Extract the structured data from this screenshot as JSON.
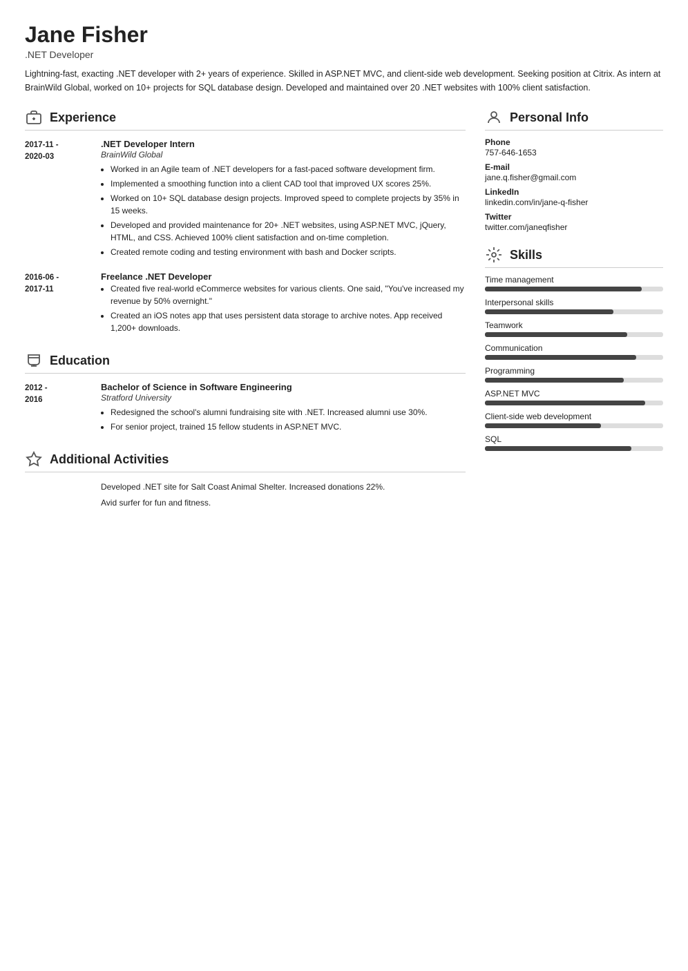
{
  "header": {
    "name": "Jane Fisher",
    "title": ".NET Developer",
    "summary": "Lightning-fast, exacting .NET developer with 2+ years of experience. Skilled in ASP.NET MVC, and client-side web development. Seeking position at Citrix. As intern at BrainWild Global, worked on 10+ projects for SQL database design. Developed and maintained over 20 .NET websites with 100% client satisfaction."
  },
  "experience": {
    "section_title": "Experience",
    "entries": [
      {
        "date_start": "2017-11 -",
        "date_end": "2020-03",
        "title": ".NET Developer Intern",
        "company": "BrainWild Global",
        "bullets": [
          "Worked in an Agile team of .NET developers for a fast-paced software development firm.",
          "Implemented a smoothing function into a client CAD tool that improved UX scores 25%.",
          "Worked on 10+ SQL database design projects. Improved speed to complete projects by 35% in 15 weeks.",
          "Developed and provided maintenance for 20+ .NET websites, using ASP.NET MVC, jQuery, HTML, and CSS. Achieved 100% client satisfaction and on-time completion.",
          "Created remote coding and testing environment with bash and Docker scripts."
        ]
      },
      {
        "date_start": "2016-06 -",
        "date_end": "2017-11",
        "title": "Freelance .NET Developer",
        "company": "",
        "bullets": [
          "Created five real-world eCommerce websites for various clients. One said, \"You've increased my revenue by 50% overnight.\"",
          "Created an iOS notes app that uses persistent data storage to archive notes. App received 1,200+ downloads."
        ]
      }
    ]
  },
  "education": {
    "section_title": "Education",
    "entries": [
      {
        "date_start": "2012 -",
        "date_end": "2016",
        "degree": "Bachelor of Science in Software Engineering",
        "school": "Stratford University",
        "bullets": [
          "Redesigned the school's alumni fundraising site with .NET. Increased alumni use 30%.",
          "For senior project, trained 15 fellow students in ASP.NET MVC."
        ]
      }
    ]
  },
  "additional_activities": {
    "section_title": "Additional Activities",
    "items": [
      "Developed .NET site for Salt Coast Animal Shelter. Increased donations 22%.",
      "Avid surfer for fun and fitness."
    ]
  },
  "personal_info": {
    "section_title": "Personal Info",
    "fields": [
      {
        "label": "Phone",
        "value": "757-646-1653"
      },
      {
        "label": "E-mail",
        "value": "jane.q.fisher@gmail.com"
      },
      {
        "label": "LinkedIn",
        "value": "linkedin.com/in/jane-q-fisher"
      },
      {
        "label": "Twitter",
        "value": "twitter.com/janeqfisher"
      }
    ]
  },
  "skills": {
    "section_title": "Skills",
    "items": [
      {
        "name": "Time management",
        "percent": 88
      },
      {
        "name": "Interpersonal skills",
        "percent": 72
      },
      {
        "name": "Teamwork",
        "percent": 80
      },
      {
        "name": "Communication",
        "percent": 85
      },
      {
        "name": "Programming",
        "percent": 78
      },
      {
        "name": "ASP.NET MVC",
        "percent": 90
      },
      {
        "name": "Client-side web development",
        "percent": 65
      },
      {
        "name": "SQL",
        "percent": 82
      }
    ]
  }
}
